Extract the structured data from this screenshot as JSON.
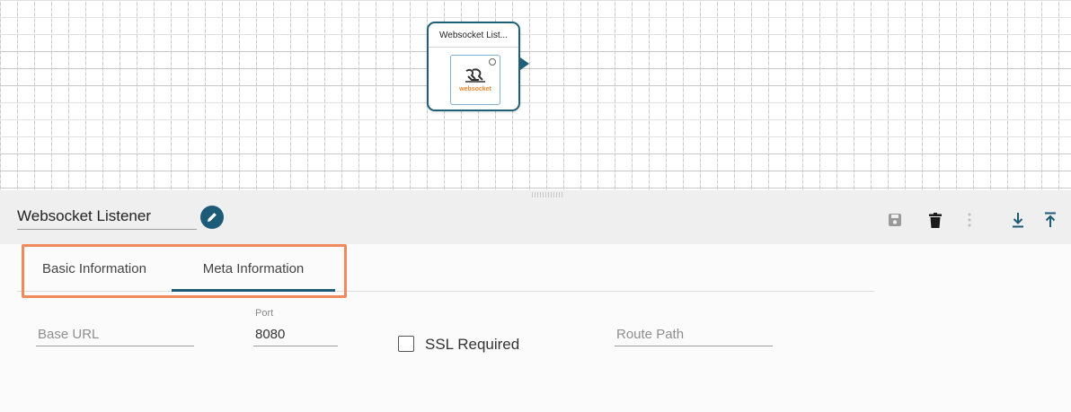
{
  "canvas": {
    "node": {
      "title": "Websocket List...",
      "icon": "websocket-icon",
      "icon_text": "websocket"
    }
  },
  "panel": {
    "component_name": "Websocket Listener",
    "toolbar": {
      "edit_icon": "pencil-icon",
      "save_icon": "save-icon",
      "delete_icon": "trash-icon",
      "more_icon": "vertical-dots-icon",
      "download_icon": "download-icon",
      "upload_icon": "upload-icon"
    },
    "tabs": [
      {
        "label": "Basic Information",
        "active": false
      },
      {
        "label": "Meta Information",
        "active": true
      }
    ],
    "form": {
      "base_url": {
        "placeholder": "Base URL",
        "value": ""
      },
      "port": {
        "label": "Port",
        "value": "8080"
      },
      "ssl_required": {
        "label": "SSL Required",
        "checked": false
      },
      "route_path": {
        "placeholder": "Route Path",
        "value": ""
      }
    }
  },
  "colors": {
    "accent": "#1c5a77",
    "highlight": "#f08a5d",
    "websocket_orange": "#f0852f"
  }
}
